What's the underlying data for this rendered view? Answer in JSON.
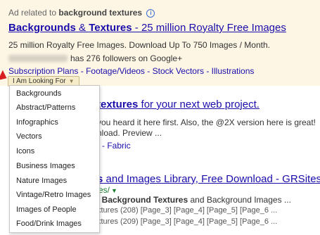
{
  "ad": {
    "label_prefix": "Ad related to",
    "label_query": "background textures",
    "title_part1": "Backgrounds",
    "title_amp": " & ",
    "title_part2": "Textures",
    "title_rest": " - 25 million Royalty Free Images",
    "description": "25 million Royalty Free Images. Download Up To 750 Images / Month.",
    "followers": "has 276 followers on Google+",
    "sitelinks": [
      "Subscription Plans",
      "Footage/Videos",
      "Stock Vectors",
      "Illustrations"
    ],
    "looking_for_label": "I Am Looking For",
    "accent_color": "#1a0dab",
    "background_color": "#fdf6e5"
  },
  "dropdown": {
    "items": [
      "Backgrounds",
      "Abstract/Patterns",
      "Infographics",
      "Vectors",
      "Icons",
      "Business Images",
      "Nature Images",
      "Vintage/Retro Images",
      "Images of People",
      "Food/Drink Images"
    ]
  },
  "result2": {
    "title_bold": "textures",
    "title_rest": " for your next web project.",
    "line1": "you heard it here first. Also, the @2X version here is great!",
    "line2": "nload. Preview ...",
    "link": "- Fabric"
  },
  "result3": {
    "title_bold": "s",
    "title_rest": " and Images Library, Free Download - GRSites",
    "url": "es/",
    "snippet_pre": "f ",
    "snippet_bold": "Background Textures",
    "snippet_post": " and Background Images ...",
    "sub1": "xtures (208)   [Page_3] [Page_4] [Page_5] [Page_6 ...",
    "sub2": "xtures (209)   [Page_3] [Page_4] [Page_5] [Page_6 ..."
  }
}
